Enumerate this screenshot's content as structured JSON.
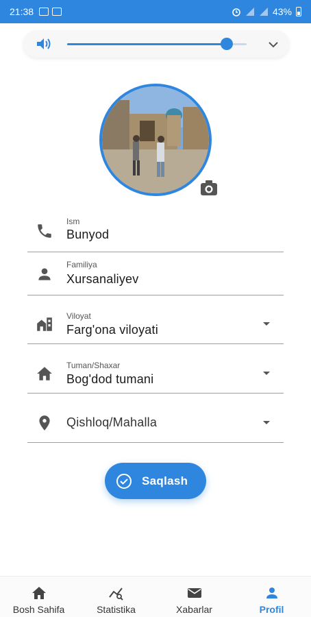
{
  "status_bar": {
    "time": "21:38",
    "battery": "43%"
  },
  "volume": {
    "level": 0.89,
    "accent": "#2f86df"
  },
  "form": {
    "fields": [
      {
        "label": "Ism",
        "value": "Bunyod",
        "icon": "phone-icon"
      },
      {
        "label": "Familiya",
        "value": "Xursanaliyev",
        "icon": "person-icon"
      },
      {
        "label": "Viloyat",
        "value": "Farg'ona viloyati",
        "icon": "city-icon"
      },
      {
        "label": "Tuman/Shaxar",
        "value": "Bog'dod tumani",
        "icon": "home-icon"
      },
      {
        "label": "",
        "value": "Qishloq/Mahalla",
        "icon": "location-pin-icon"
      }
    ]
  },
  "save_button": {
    "label": "Saqlash"
  },
  "bottom_nav": {
    "items": [
      {
        "label": "Bosh Sahifa",
        "icon": "home-icon"
      },
      {
        "label": "Statistika",
        "icon": "chart-icon"
      },
      {
        "label": "Xabarlar",
        "icon": "mail-icon"
      },
      {
        "label": "Profil",
        "icon": "profile-icon"
      }
    ],
    "active": "Profil"
  }
}
